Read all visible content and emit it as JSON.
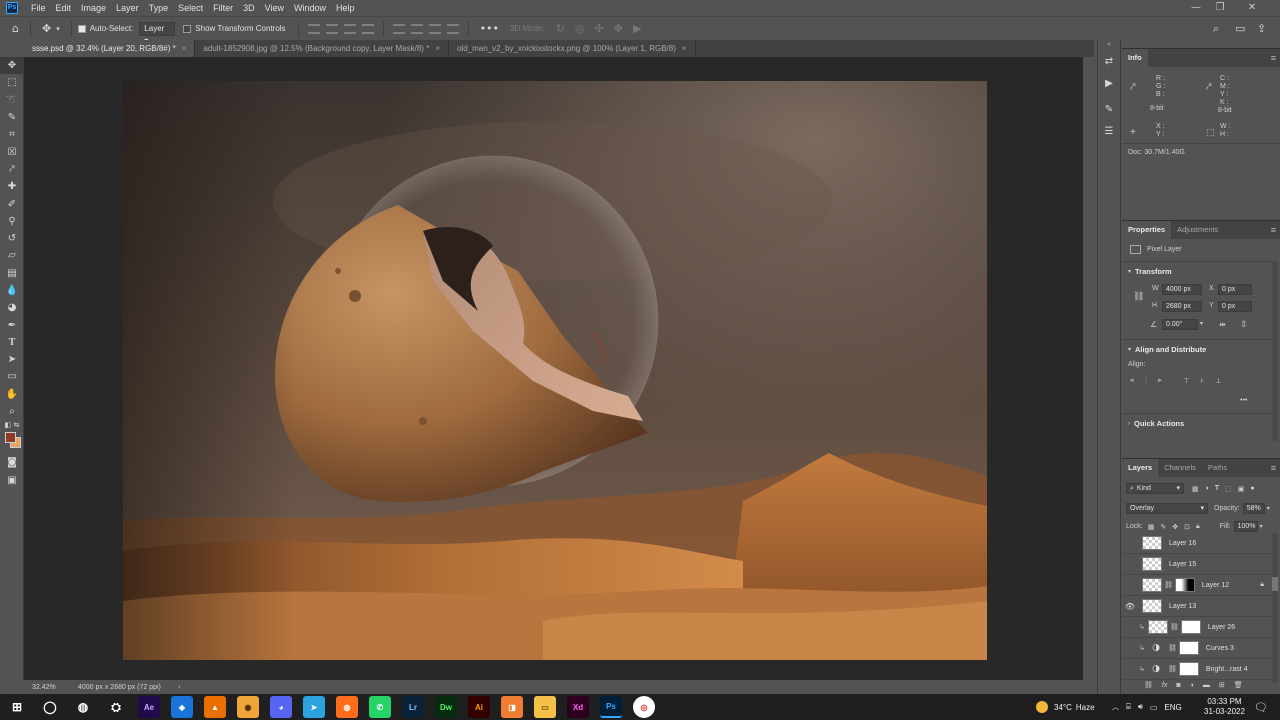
{
  "menubar": {
    "items": [
      "File",
      "Edit",
      "Image",
      "Layer",
      "Type",
      "Select",
      "Filter",
      "3D",
      "View",
      "Window",
      "Help"
    ],
    "logo": "Ps"
  },
  "options": {
    "auto_select_label": "Auto-Select:",
    "auto_select_target": "Layer",
    "show_transform_label": "Show Transform Controls",
    "mode_3d_label": "3D Mode:"
  },
  "tabs": [
    {
      "label": "ssse.psd @ 32.4% (Layer 20, RGB/8#) *",
      "active": true
    },
    {
      "label": "adult-1852908.jpg @ 12.5% (Background copy, Layer Mask/8) *",
      "active": false
    },
    {
      "label": "old_man_v2_by_xnickixstockx.png @ 100% (Layer 1, RGB/8)",
      "active": false
    }
  ],
  "status": {
    "zoom": "32.42%",
    "doc_size": "4000 px x 2680 px (72 ppi)",
    "arrow": "›"
  },
  "info_panel": {
    "title": "Info",
    "rgb_labels": [
      "R :",
      "G :",
      "B :"
    ],
    "cmyk_labels": [
      "C :",
      "M :",
      "Y :",
      "K :"
    ],
    "bit_left": "8-bit",
    "bit_right": "8-bit",
    "xy_labels": [
      "X :",
      "Y :"
    ],
    "wh_labels": [
      "W :",
      "H :"
    ],
    "doc": "Doc: 30.7M/1.40G"
  },
  "properties_panel": {
    "tab_properties": "Properties",
    "tab_adjustments": "Adjustments",
    "pixel_layer": "Pixel Layer",
    "transform_title": "Transform",
    "w_label": "W",
    "w_value": "4000 px",
    "h_label": "H",
    "h_value": "2680 px",
    "x_label": "X",
    "x_value": "0 px",
    "y_label": "Y",
    "y_value": "0 px",
    "angle_value": "0.00°",
    "align_title": "Align and Distribute",
    "align_label": "Align:",
    "more": "•••",
    "quick_actions_title": "Quick Actions"
  },
  "layers_panel": {
    "tab_layers": "Layers",
    "tab_channels": "Channels",
    "tab_paths": "Paths",
    "filter_kind": "Kind",
    "blend_mode": "Overlay",
    "opacity_label": "Opacity:",
    "opacity_value": "58%",
    "lock_label": "Lock:",
    "fill_label": "Fill:",
    "fill_value": "100%",
    "layers": [
      {
        "name": "Layer 16",
        "visible": false,
        "kind": "pixel"
      },
      {
        "name": "Layer 15",
        "visible": false,
        "kind": "pixel"
      },
      {
        "name": "Layer 12",
        "visible": false,
        "kind": "masked"
      },
      {
        "name": "Layer 13",
        "visible": true,
        "kind": "pixel"
      },
      {
        "name": "Layer 26",
        "visible": false,
        "kind": "clipped-masked"
      },
      {
        "name": "Curves 3",
        "visible": false,
        "kind": "adjustment"
      },
      {
        "name": "Bright...rast 4",
        "visible": false,
        "kind": "adjustment"
      }
    ]
  },
  "taskbar": {
    "temperature": "34°C",
    "weather": "Haze",
    "language": "ENG",
    "time": "03:33 PM",
    "date": "31-03-2022",
    "apps": [
      {
        "label": "Ae",
        "color": "#1f0a4a",
        "fg": "#c9a6ff"
      },
      {
        "label": "◈",
        "color": "#1a73d9",
        "fg": "#ffffff"
      },
      {
        "label": "▲",
        "color": "#e96f00",
        "fg": "#ffffff"
      },
      {
        "label": "◉",
        "color": "#f0a53b",
        "fg": "#4a2b00"
      },
      {
        "label": "◕",
        "color": "#5865f2",
        "fg": "#ffffff"
      },
      {
        "label": "➤",
        "color": "#2aa3de",
        "fg": "#ffffff"
      },
      {
        "label": "◍",
        "color": "#ff6d1a",
        "fg": "#ffffff"
      },
      {
        "label": "✆",
        "color": "#25d366",
        "fg": "#ffffff"
      },
      {
        "label": "Lr",
        "color": "#0b2236",
        "fg": "#74c6ff"
      },
      {
        "label": "Dw",
        "color": "#072b0f",
        "fg": "#4ef06f"
      },
      {
        "label": "Ai",
        "color": "#330000",
        "fg": "#ff9a00"
      },
      {
        "label": "◨",
        "color": "#f07c32",
        "fg": "#ffffff"
      },
      {
        "label": "▭",
        "color": "#f3c04a",
        "fg": "#7a5200"
      },
      {
        "label": "Xd",
        "color": "#2e001f",
        "fg": "#ff61f6"
      },
      {
        "label": "Ps",
        "color": "#001e36",
        "fg": "#31a8ff"
      },
      {
        "label": "◎",
        "color": "#ffffff",
        "fg": "#d93025"
      }
    ]
  },
  "colors": {
    "foreground": "#8b3d23",
    "background": "#e8a361"
  }
}
